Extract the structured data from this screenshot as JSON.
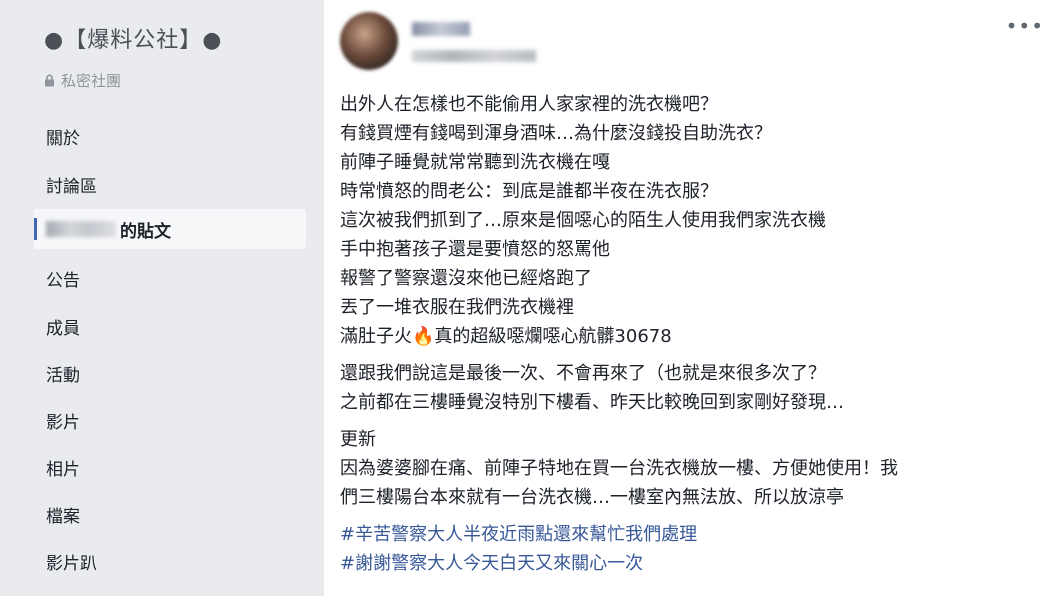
{
  "sidebar": {
    "group_name": "●【爆料公社】●",
    "privacy": "私密社團",
    "active_item_label": "的貼文",
    "items": [
      "關於",
      "討論區",
      "公告",
      "成員",
      "活動",
      "影片",
      "相片",
      "檔案",
      "影片趴"
    ]
  },
  "post": {
    "paragraphs": [
      [
        "出外人在怎樣也不能偷用人家家裡的洗衣機吧？",
        "有錢買煙有錢喝到渾身酒味…為什麼沒錢投自助洗衣？",
        "前陣子睡覺就常常聽到洗衣機在嘎",
        "時常憤怒的問老公：到底是誰都半夜在洗衣服？",
        "這次被我們抓到了…原來是個噁心的陌生人使用我們家洗衣機",
        "手中抱著孩子還是要憤怒的怒罵他",
        "報警了警察還沒來他已經烙跑了",
        "丟了一堆衣服在我們洗衣機裡"
      ],
      [
        "還跟我們說這是最後一次、不會再來了（也就是來很多次了？",
        "之前都在三樓睡覺沒特別下樓看、昨天比較晚回到家剛好發現…"
      ],
      [
        "更新",
        "因為婆婆腳在痛、前陣子特地在買一台洗衣機放一樓、方便她使用！我",
        "們三樓陽台本來就有一台洗衣機…一樓室內無法放、所以放涼亭"
      ]
    ],
    "fire_line": {
      "before": "滿肚子火",
      "emoji": "🔥",
      "after": "真的超級噁爛噁心航髒30678"
    },
    "hashtags": [
      "#辛苦警察大人半夜近雨點還來幫忙我們處理",
      "#謝謝警察大人今天白天又來關心一次"
    ],
    "more_label": "•••"
  }
}
